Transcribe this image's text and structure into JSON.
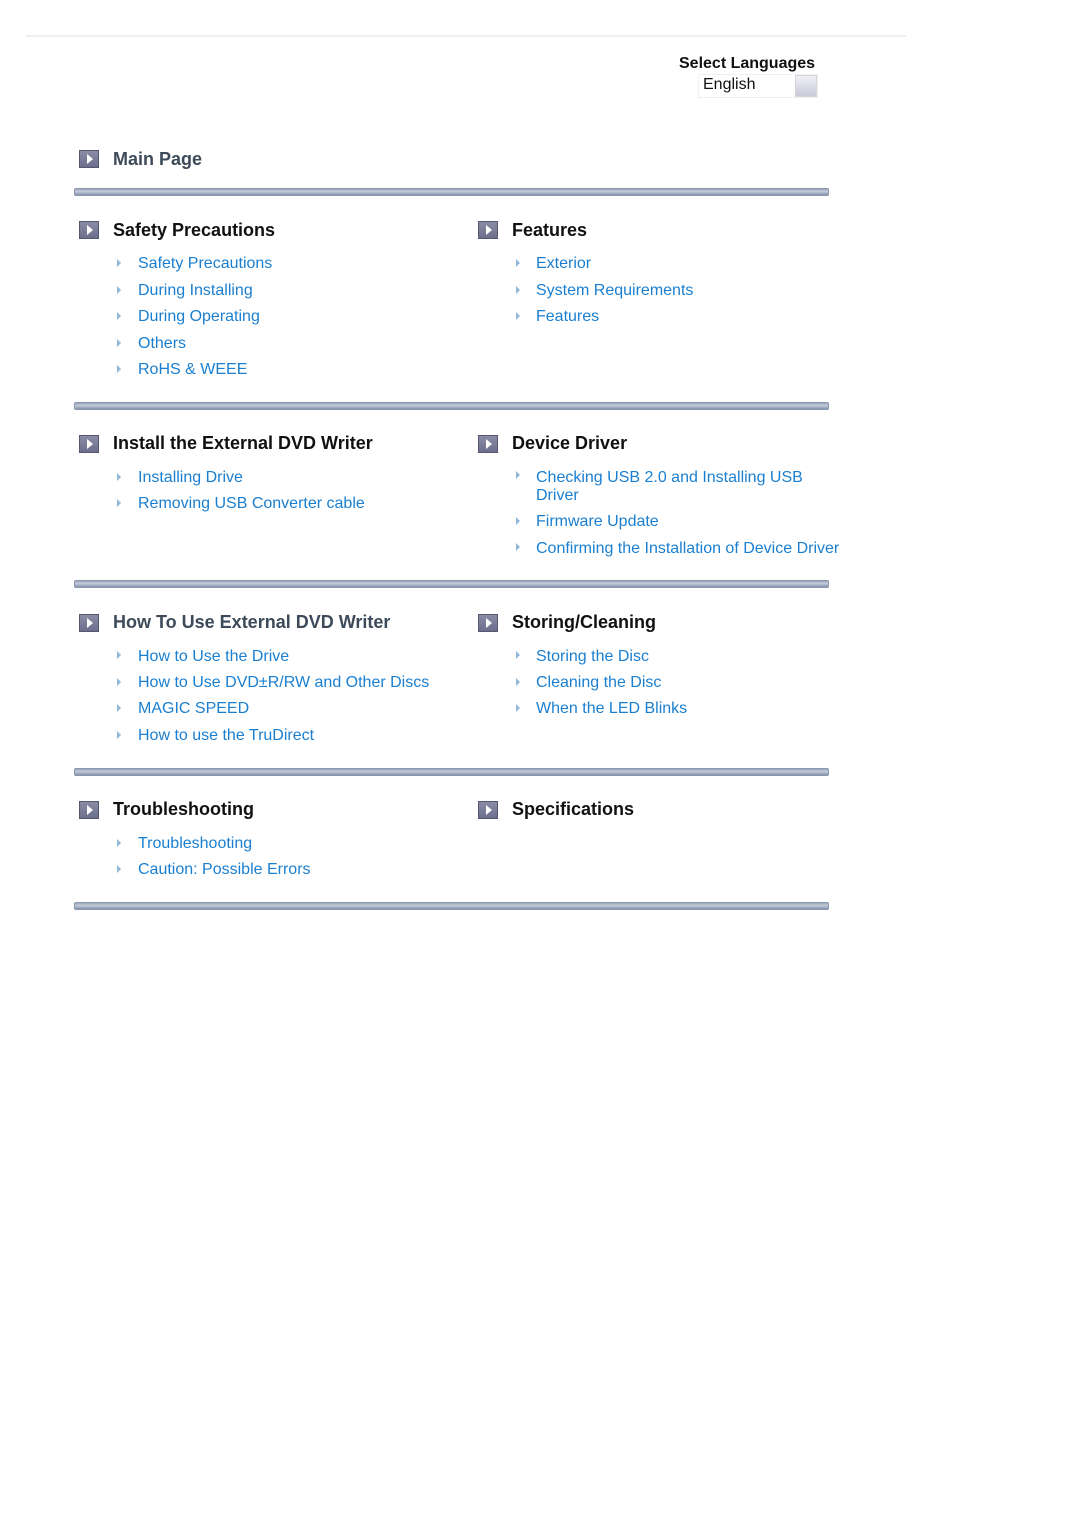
{
  "language": {
    "title": "Select Languages",
    "selected": "English"
  },
  "main_page": {
    "label": "Main Page"
  },
  "sections": {
    "safety": {
      "title": "Safety Precautions",
      "links": [
        "Safety Precautions",
        "During Installing",
        "During Operating",
        "Others",
        "RoHS & WEEE"
      ]
    },
    "features": {
      "title": "Features",
      "links": [
        "Exterior",
        "System Requirements",
        "Features"
      ]
    },
    "install": {
      "title": "Install the External DVD Writer",
      "links": [
        "Installing Drive",
        "Removing USB Converter cable"
      ]
    },
    "driver": {
      "title": "Device Driver",
      "links": [
        "Checking USB 2.0 and Installing USB",
        "Driver",
        "Firmware Update",
        "Confirming the Installation of Device Driver"
      ]
    },
    "howto": {
      "title": "How To Use External DVD Writer",
      "links": [
        "How to Use the Drive",
        "How to Use DVD±R/RW and Other Discs",
        "MAGIC SPEED",
        "How to use the TruDirect"
      ]
    },
    "storing": {
      "title": "Storing/Cleaning",
      "links": [
        "Storing the Disc",
        "Cleaning the Disc",
        "When the LED Blinks"
      ]
    },
    "troubleshooting": {
      "title": "Troubleshooting",
      "links": [
        "Troubleshooting",
        "Caution: Possible Errors"
      ]
    },
    "specifications": {
      "title": "Specifications"
    }
  }
}
